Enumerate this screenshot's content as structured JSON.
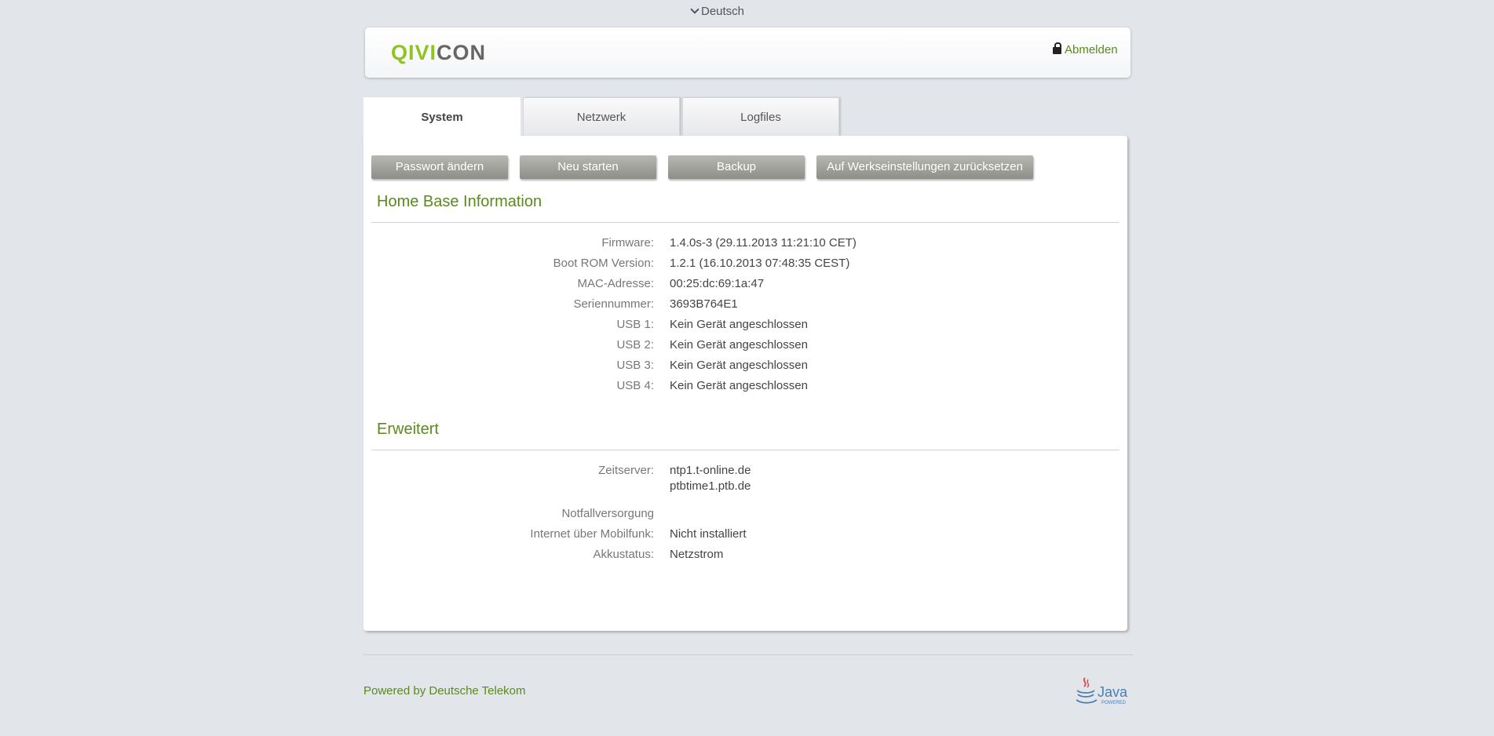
{
  "language": {
    "label": "Deutsch"
  },
  "header": {
    "logo_mark": "QIVI",
    "logo_rest": "CON",
    "logout_label": "Abmelden"
  },
  "tabs": [
    {
      "label": "System",
      "active": true
    },
    {
      "label": "Netzwerk",
      "active": false
    },
    {
      "label": "Logfiles",
      "active": false
    }
  ],
  "actions": {
    "change_password": "Passwort ändern",
    "restart": "Neu starten",
    "backup": "Backup",
    "factory_reset": "Auf Werkseinstellungen zurücksetzen"
  },
  "home_base": {
    "title": "Home Base Information",
    "rows": [
      {
        "label": "Firmware:",
        "value": "1.4.0s-3 (29.11.2013 11:21:10 CET)"
      },
      {
        "label": "Boot ROM Version:",
        "value": "1.2.1 (16.10.2013 07:48:35 CEST)"
      },
      {
        "label": "MAC-Adresse:",
        "value": "00:25:dc:69:1a:47"
      },
      {
        "label": "Seriennummer:",
        "value": "3693B764E1"
      },
      {
        "label": "USB 1:",
        "value": "Kein Gerät angeschlossen"
      },
      {
        "label": "USB 2:",
        "value": "Kein Gerät angeschlossen"
      },
      {
        "label": "USB 3:",
        "value": "Kein Gerät angeschlossen"
      },
      {
        "label": "USB 4:",
        "value": "Kein Gerät angeschlossen"
      }
    ]
  },
  "advanced": {
    "title": "Erweitert",
    "timeserver_label": "Zeitserver:",
    "timeservers": [
      "ntp1.t-online.de",
      "ptbtime1.ptb.de"
    ],
    "emergency_label": "Notfallversorgung",
    "mobile_label": "Internet über Mobilfunk:",
    "mobile_value": "Nicht installiert",
    "battery_label": "Akkustatus:",
    "battery_value": "Netzstrom"
  },
  "footer": {
    "powered_by": "Powered by Deutsche Telekom",
    "java_label": "Java",
    "java_sub": "POWERED"
  },
  "colors": {
    "accent_green": "#5a8a1c",
    "logo_green": "#8fc31f",
    "button_gray": "#9e9e98",
    "background": "#e2e5ea"
  }
}
